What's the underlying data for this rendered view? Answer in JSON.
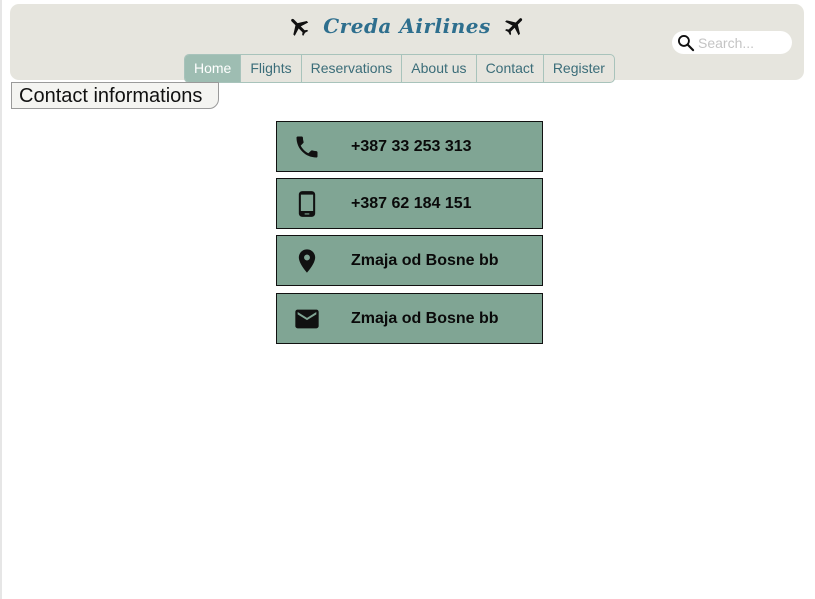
{
  "header": {
    "title": "Creda Airlines",
    "left_icon": "airplane-icon",
    "right_icon": "airplane-icon",
    "title_color": "#2e6f8e",
    "background": "#e6e5de"
  },
  "search": {
    "placeholder": "Search...",
    "value": "",
    "icon": "search-icon"
  },
  "nav": {
    "items": [
      {
        "label": "Home",
        "active": true
      },
      {
        "label": "Flights",
        "active": false
      },
      {
        "label": "Reservations",
        "active": false
      },
      {
        "label": "About us",
        "active": false
      },
      {
        "label": "Contact",
        "active": false
      },
      {
        "label": "Register",
        "active": false
      }
    ],
    "active_color": "#9ebdb2"
  },
  "section": {
    "title": "Contact informations"
  },
  "contacts": [
    {
      "icon": "phone-icon",
      "text": "+387 33 253 313"
    },
    {
      "icon": "mobile-phone-icon",
      "text": "+387 62 184 151"
    },
    {
      "icon": "location-pin-icon",
      "text": "Zmaja od Bosne bb"
    },
    {
      "icon": "mail-icon",
      "text": "Zmaja od Bosne bb"
    }
  ],
  "card_color": "#80a594"
}
